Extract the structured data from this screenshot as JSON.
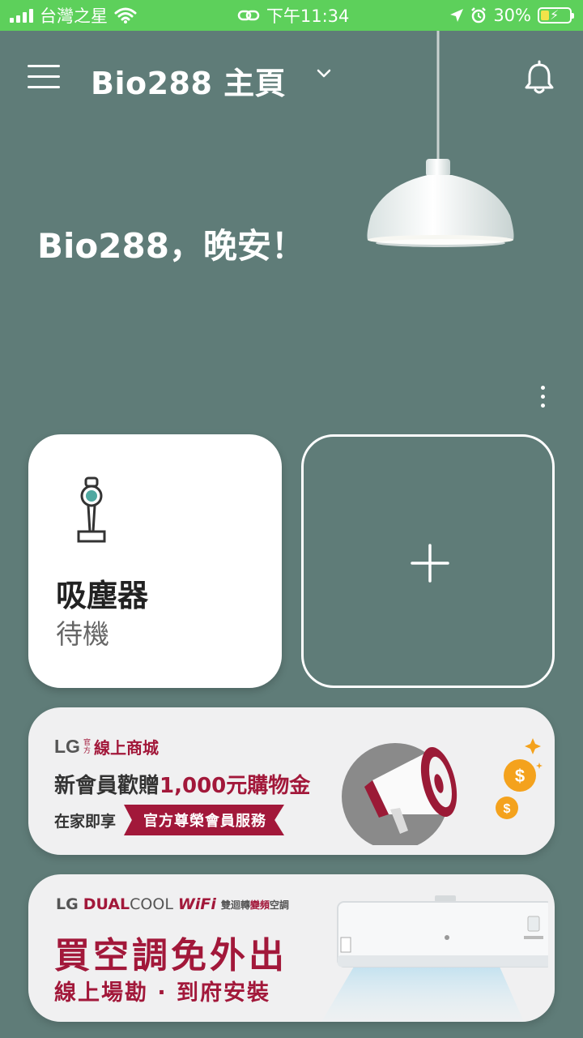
{
  "status_bar": {
    "carrier": "台灣之星",
    "time": "下午11:34",
    "battery": "30%",
    "battery_level": 0.3
  },
  "header": {
    "title": "Bio288 主頁"
  },
  "greeting": "Bio288，晚安！",
  "devices": [
    {
      "name": "吸塵器",
      "status": "待機"
    }
  ],
  "banners": {
    "shop": {
      "lg": "LG",
      "lg_sub_top": "官",
      "lg_sub_bottom": "方",
      "shop_name": "線上商城",
      "headline_pre": "新會員歡贈",
      "headline_amount": "1,000元購物金",
      "sub_pre": "在家即享",
      "ribbon": "官方尊榮會員服務"
    },
    "aircon": {
      "lg": "LG",
      "dual": "DUAL",
      "cool": "COOL",
      "wifi": "WiFi",
      "desc_a": "雙迴轉",
      "desc_hl": "變頻",
      "desc_b": "空調",
      "headline": "買空調免外出",
      "subline": "線上場勘 · 到府安裝"
    }
  },
  "colors": {
    "background": "#5f7c78",
    "status_bar": "#5dd05b",
    "brand": "#a2183a",
    "card": "#ffffff"
  }
}
